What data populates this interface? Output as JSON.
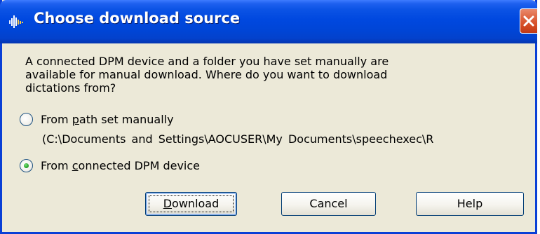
{
  "window": {
    "title": "Choose download source",
    "close_glyph": "✕"
  },
  "message": "A connected DPM device and a folder you have set manually are\navailable for manual download. Where do you want to download\ndictations from?",
  "options": [
    {
      "pre": "From ",
      "mnemonic": "p",
      "post": "ath set manually",
      "selected": false
    },
    {
      "pre": "From ",
      "mnemonic": "c",
      "post": "onnected DPM device",
      "selected": true
    }
  ],
  "manual_path": "(C:\\Documents and Settings\\AOCUSER\\My Documents\\speechexec\\R",
  "buttons": {
    "download": {
      "mnemonic": "D",
      "rest": "ownload"
    },
    "cancel": "Cancel",
    "help": "Help"
  },
  "colors": {
    "title_bar": "#0048df",
    "dialog_bg": "#ece9d8",
    "close_button": "#d44a22",
    "radio_dot": "#2aa52a"
  },
  "icons": {
    "app": "sound-wave-icon",
    "close": "close-icon"
  }
}
